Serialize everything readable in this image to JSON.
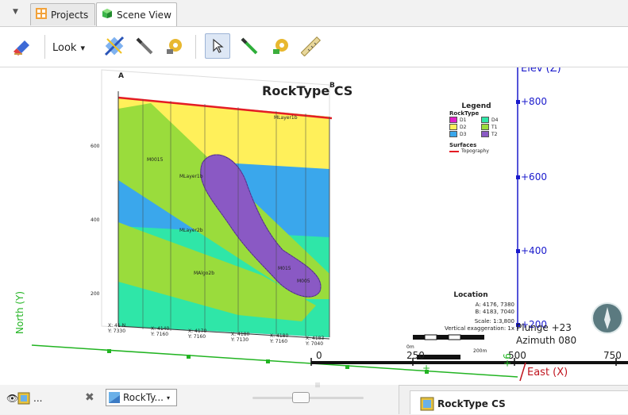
{
  "tabs": {
    "dropdown_glyph": "▼",
    "items": [
      {
        "label": "Projects",
        "icon": "projects-grid-icon",
        "active": false
      },
      {
        "label": "Scene View",
        "icon": "scene-cube-icon",
        "active": true
      }
    ]
  },
  "toolbar": {
    "look_label": "Look",
    "look_arrow": "▾",
    "tools": [
      "eraser-icon",
      "look-menu",
      "slice-icon",
      "draw-line-icon",
      "gear-tool-icon",
      "select-arrow-icon",
      "draw-green-icon",
      "settings-green-icon",
      "ruler-icon"
    ]
  },
  "section": {
    "title": "RockType CS",
    "corner_a": "A",
    "corner_b": "B",
    "y_ticks": [
      "600",
      "400",
      "200"
    ],
    "bottom_ticks": [
      [
        "X: 41 N",
        "Y: 7330"
      ],
      [
        "X: 4140",
        "Y: 7160"
      ],
      [
        "X: 4170",
        "Y: 7160"
      ],
      [
        "X: 4180",
        "Y: 7130"
      ],
      [
        "X: 4180",
        "Y: 7160"
      ],
      [
        "X: 4183",
        "Y: 7040"
      ]
    ],
    "unit_labels": [
      "MLayer1b",
      "M0015",
      "MLayer1b",
      "MLayer2b",
      "MAlgo2b",
      "M015",
      "M005"
    ],
    "legend": {
      "title": "Legend",
      "subtitle": "RockType",
      "items": [
        {
          "code": "D1",
          "color": "#e020c8"
        },
        {
          "code": "D4",
          "color": "#2fe6a8"
        },
        {
          "code": "D2",
          "color": "#fff05a"
        },
        {
          "code": "T1",
          "color": "#9adc3c"
        },
        {
          "code": "D3",
          "color": "#3aa7ec"
        },
        {
          "code": "T2",
          "color": "#8a59c4"
        }
      ],
      "surfaces_title": "Surfaces",
      "surface_item": "Topography",
      "surface_color": "#e41c24"
    },
    "location": {
      "title": "Location",
      "a": "A:  4176, 7380",
      "b": "B:  4183, 7040",
      "scale": "Scale: 1:3,800",
      "exag": "Vertical exaggeration: 1x",
      "bar_start": "0m",
      "bar_end": "200m"
    }
  },
  "scene": {
    "elev_label": "Elev (Z)",
    "elev_ticks": [
      "+800",
      "+600",
      "+400",
      "+200"
    ],
    "north_label": "North (Y)",
    "east_label": "East (X)",
    "east_ticks": [
      "0",
      "250",
      "500",
      "750"
    ],
    "green_ticks": [
      "+",
      "+6"
    ],
    "plunge": "Plunge +23",
    "azimuth": "Azimuth 080",
    "axis_blue": "#1a1acc",
    "axis_green": "#22b422",
    "axis_red": "#c0141e"
  },
  "bottom": {
    "left_label": "...",
    "layer_select": "RockTy...",
    "grip": "|||",
    "right_title": "RockType CS"
  }
}
